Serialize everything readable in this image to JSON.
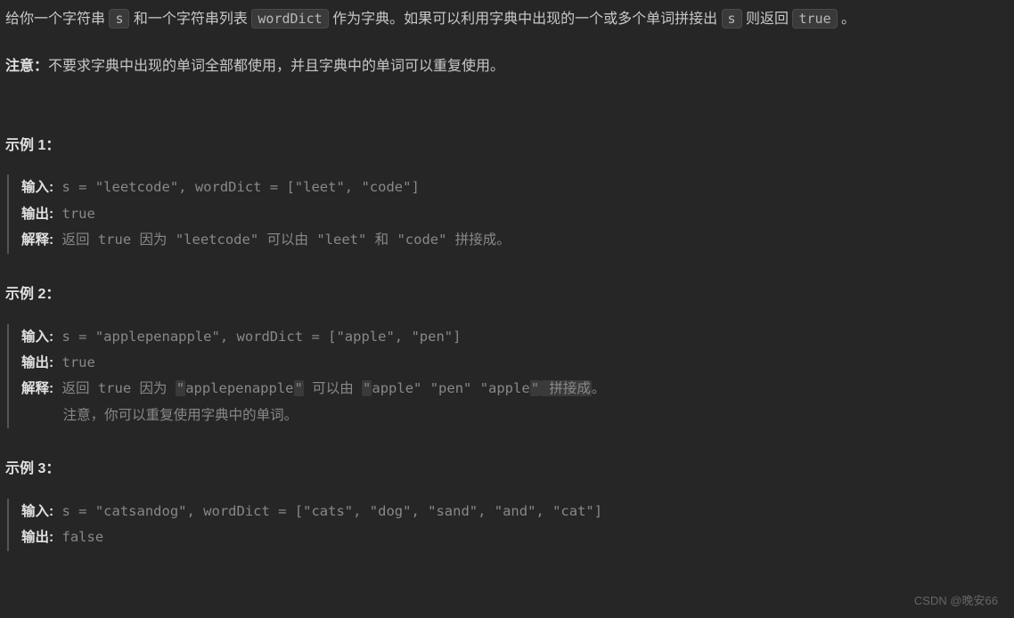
{
  "intro": {
    "part1": "给你一个字符串 ",
    "codeS": "s",
    "part2": " 和一个字符串列表 ",
    "codeDict": "wordDict",
    "part3": " 作为字典。如果可以利用字典中出现的一个或多个单词拼接出 ",
    "codeS2": "s",
    "part4": " 则返回 ",
    "codeTrue": "true",
    "part5": " 。"
  },
  "note": {
    "label": "注意：",
    "text": "不要求字典中出现的单词全部都使用，并且字典中的单词可以重复使用。"
  },
  "example1": {
    "heading": "示例 1：",
    "inputLabel": "输入:",
    "inputText": "s = \"leetcode\", wordDict = [\"leet\", \"code\"]",
    "outputLabel": "输出:",
    "outputText": "true",
    "explainLabel": "解释:",
    "explainText": "返回 true 因为 \"leetcode\" 可以由 \"leet\" 和 \"code\" 拼接成。"
  },
  "example2": {
    "heading": "示例 2：",
    "inputLabel": "输入:",
    "inputText": "s = \"applepenapple\", wordDict = [\"apple\", \"pen\"]",
    "outputLabel": "输出:",
    "outputText": "true",
    "explainLabel": "解释:",
    "explainP1": "返回 true 因为 ",
    "explainQ1a": "\"",
    "explainQ1b": "applepenapple",
    "explainQ1c": "\"",
    "explainP2": " 可以由 ",
    "explainQ2a": "\"",
    "explainQ2b": "apple\" \"pen\" \"apple",
    "explainQ2c": "\"",
    "explainP3": " 拼接成",
    "explainP4": "。",
    "explainLine2": "     注意，你可以重复使用字典中的单词。"
  },
  "example3": {
    "heading": "示例 3：",
    "inputLabel": "输入:",
    "inputText": "s = \"catsandog\", wordDict = [\"cats\", \"dog\", \"sand\", \"and\", \"cat\"]",
    "outputLabel": "输出:",
    "outputText": "false"
  },
  "watermark": "CSDN @晚安66"
}
